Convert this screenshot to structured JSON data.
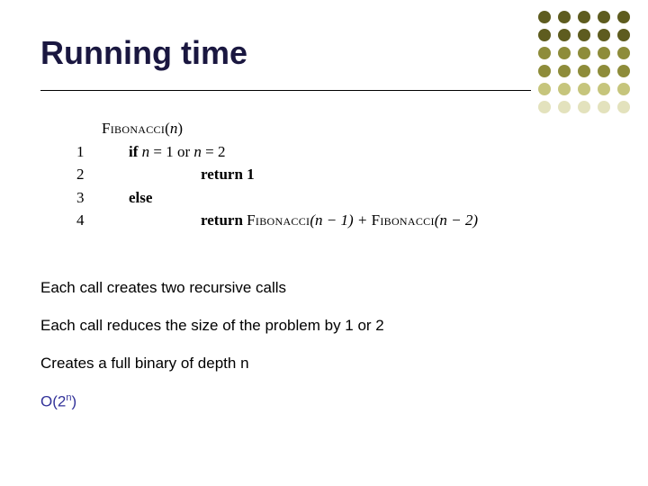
{
  "title": "Running time",
  "pseudocode": {
    "header_fn": "Fibonacci",
    "header_arg": "n",
    "lines": {
      "l1_num": "1",
      "l1_kw": "if",
      "l1_cond_a": "n",
      "l1_eq1": " = 1 ",
      "l1_or": "or",
      "l1_cond_b": " n",
      "l1_eq2": " = 2",
      "l2_num": "2",
      "l2_ret": "return 1",
      "l3_num": "3",
      "l3_kw": "else",
      "l4_num": "4",
      "l4_ret": "return ",
      "l4_fnA": "Fibonacci",
      "l4_argA": "(n − 1) + ",
      "l4_fnB": "Fibonacci",
      "l4_argB": "(n − 2)"
    }
  },
  "bullets": {
    "b1": "Each call creates two recursive calls",
    "b2": "Each call reduces the size of the problem by 1 or 2",
    "b3": "Creates a full binary of depth n",
    "bigO_prefix": "O(2",
    "bigO_exp": "n",
    "bigO_suffix": ")"
  },
  "dots_colors": [
    "#5e5c1f",
    "#5e5c1f",
    "#5e5c1f",
    "#5e5c1f",
    "#5e5c1f",
    "#5e5c1f",
    "#5e5c1f",
    "#5e5c1f",
    "#5e5c1f",
    "#5e5c1f",
    "#8e8c3a",
    "#8e8c3a",
    "#8e8c3a",
    "#8e8c3a",
    "#8e8c3a",
    "#8e8c3a",
    "#8e8c3a",
    "#8e8c3a",
    "#8e8c3a",
    "#8e8c3a",
    "#c6c57c",
    "#c6c57c",
    "#c6c57c",
    "#c6c57c",
    "#c6c57c",
    "#e3e2bd",
    "#e3e2bd",
    "#e3e2bd",
    "#e3e2bd",
    "#e3e2bd"
  ]
}
